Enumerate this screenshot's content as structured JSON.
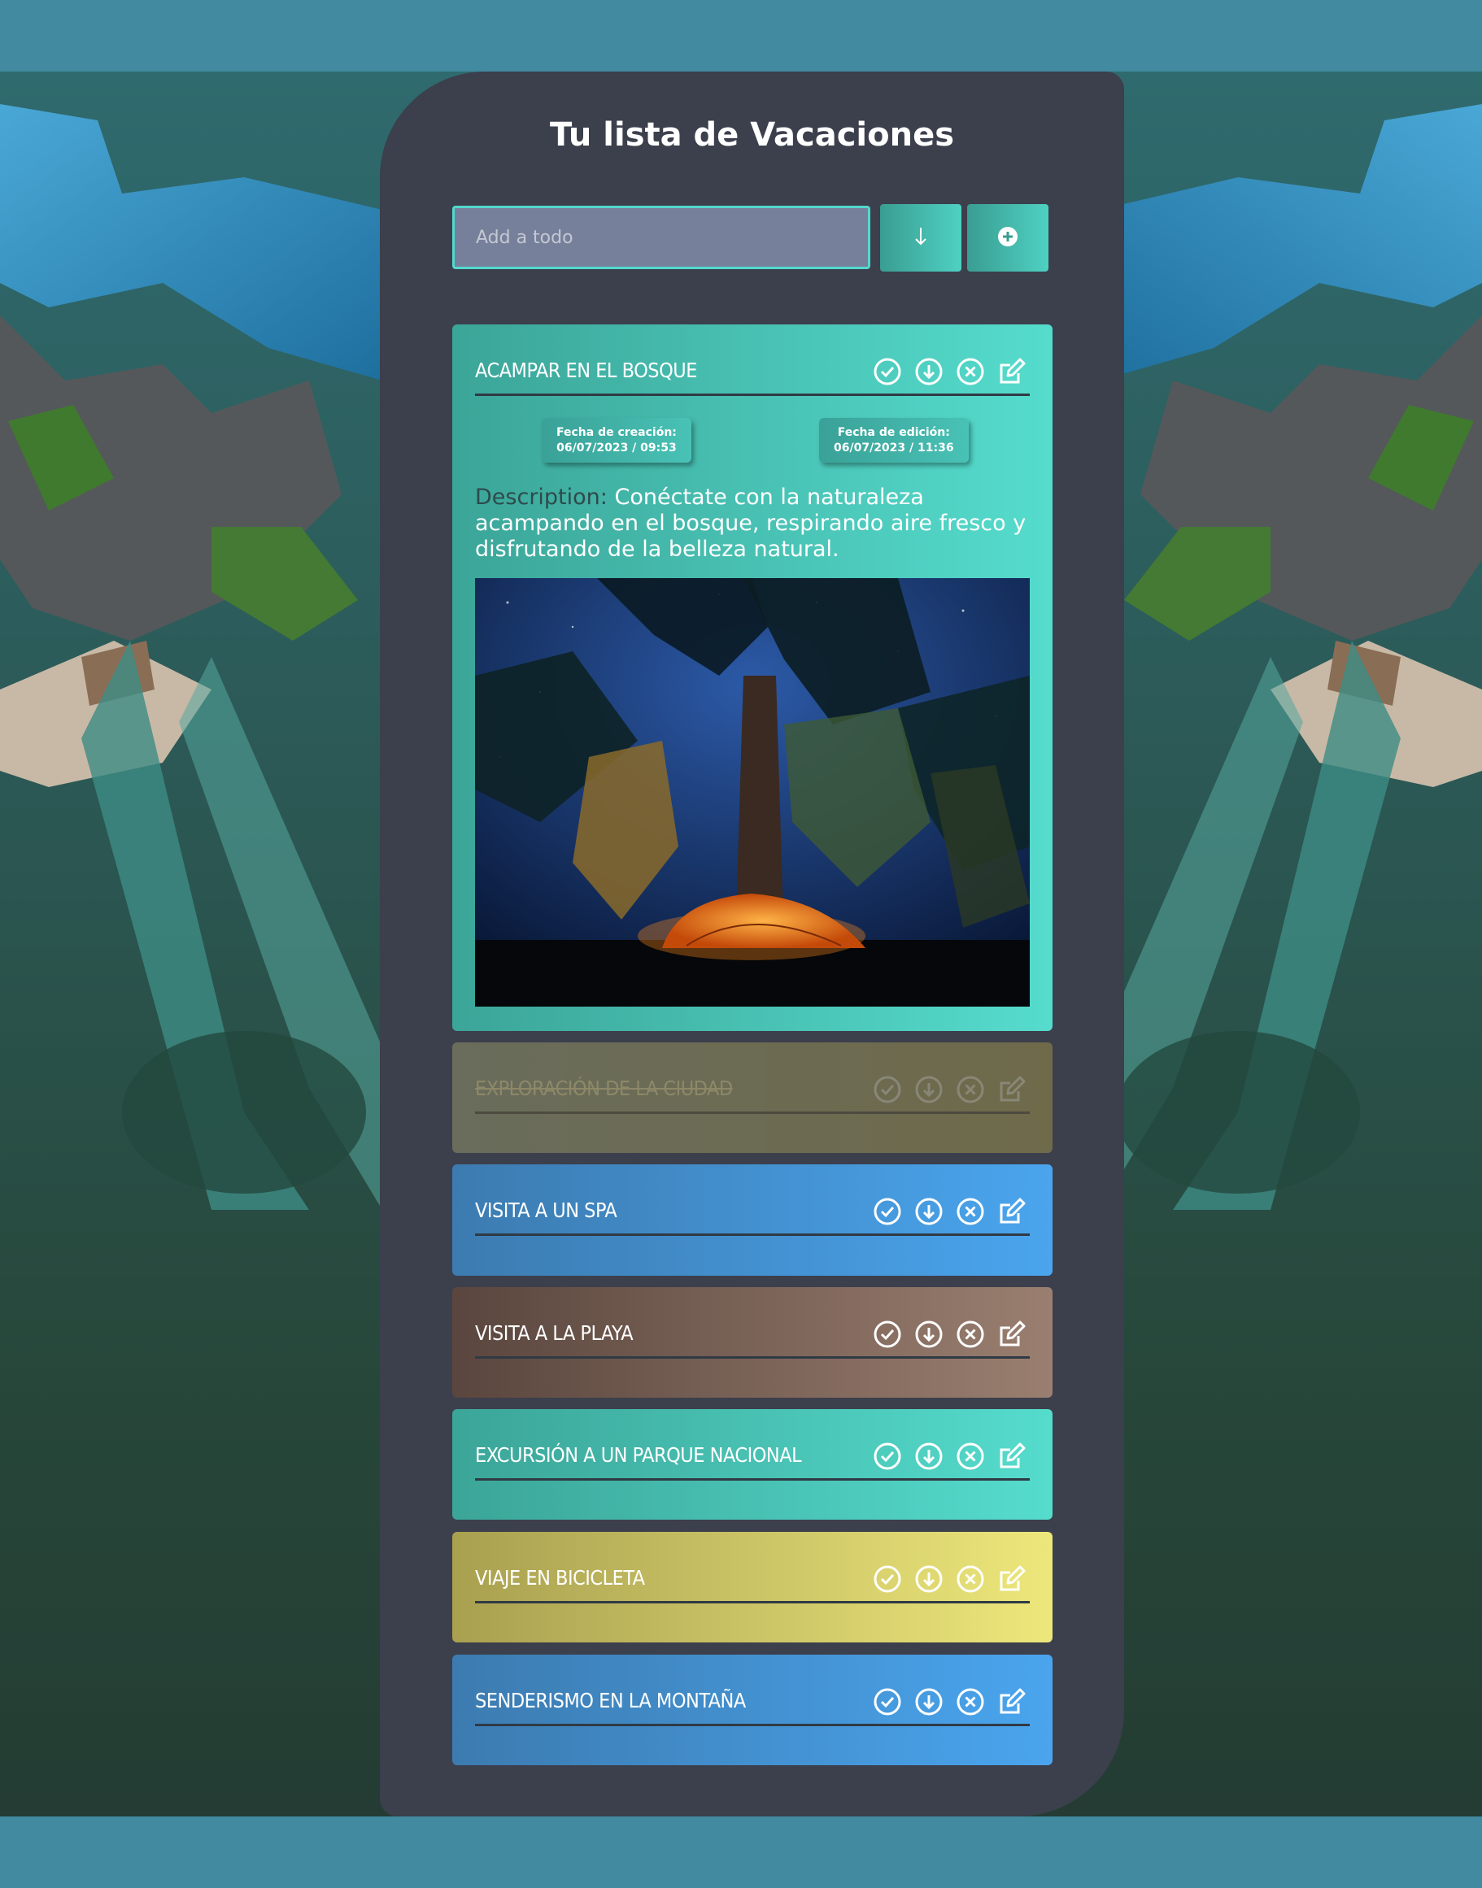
{
  "header": {
    "title": "Tu lista de Vacaciones"
  },
  "form": {
    "placeholder": "Add a todo",
    "sort_icon": "arrow-down-icon",
    "add_icon": "plus-circle-icon"
  },
  "todos": [
    {
      "title": "ACAMPAR EN EL BOSQUE",
      "color": "#4ed1c2",
      "expanded": true,
      "completed": false,
      "created_label": "Fecha de creación:",
      "created_value": "06/07/2023 / 09:53",
      "edited_label": "Fecha de edición:",
      "edited_value": "06/07/2023 / 11:36",
      "description_label": "Description:",
      "description": "Conéctate con la naturaleza acampando en el bosque, respirando aire fresco y disfrutando de la belleza natural."
    },
    {
      "title": "EXPLORACIÓN DE LA CIUDAD",
      "color": "#6b6a52",
      "completed": true
    },
    {
      "title": "VISITA A UN SPA",
      "color": "#4aa5ee",
      "completed": false
    },
    {
      "title": "VISITA A LA PLAYA",
      "color": "#9a7f70",
      "completed": false
    },
    {
      "title": "EXCURSIÓN A UN PARQUE NACIONAL",
      "color": "#4ed1c2",
      "completed": false
    },
    {
      "title": "VIAJE EN BICICLETA",
      "color": "#ede77b",
      "completed": false
    },
    {
      "title": "SENDERISMO EN LA MONTAÑA",
      "color": "#4aa5ee",
      "completed": false
    }
  ],
  "action_icons": [
    "check-circle-icon",
    "download-circle-icon",
    "close-circle-icon",
    "edit-icon"
  ]
}
